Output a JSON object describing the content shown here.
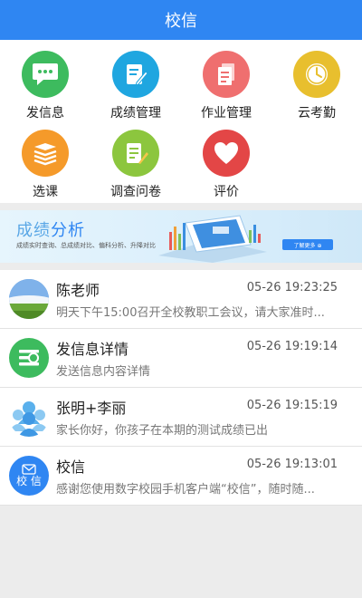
{
  "header": {
    "title": "校信"
  },
  "menu": [
    {
      "label": "发信息",
      "icon": "chat-bubble-icon",
      "color": "#3dbb5e"
    },
    {
      "label": "成绩管理",
      "icon": "edit-document-icon",
      "color": "#1fa6e0"
    },
    {
      "label": "作业管理",
      "icon": "documents-icon",
      "color": "#ef6f6f"
    },
    {
      "label": "云考勤",
      "icon": "clock-icon",
      "color": "#e8bf2e"
    },
    {
      "label": "选课",
      "icon": "book-stack-icon",
      "color": "#f59a2a"
    },
    {
      "label": "调查问卷",
      "icon": "survey-pencil-icon",
      "color": "#8cc63e"
    },
    {
      "label": "评价",
      "icon": "heart-icon",
      "color": "#e34646"
    }
  ],
  "banner": {
    "title_a": "成绩",
    "title_b": "分析",
    "subtitle": "成绩实时查询、总成绩对比、偏科分析、升降对比",
    "button": "了解更多 ⊕"
  },
  "messages": [
    {
      "name": "陈老师",
      "time": "05-26 19:23:25",
      "text": "明天下午15:00召开全校教职工会议，请大家准时...",
      "avatar": "landscape-avatar"
    },
    {
      "name": "发信息详情",
      "time": "05-26 19:19:14",
      "text": "发送信息内容详情",
      "avatar": "message-list-icon"
    },
    {
      "name": "张明+李丽",
      "time": "05-26 19:15:19",
      "text": "家长你好，你孩子在本期的测试成绩已出",
      "avatar": "group-users-icon"
    },
    {
      "name": "校信",
      "time": "05-26 19:13:01",
      "text": "感谢您使用数字校园手机客户端“校信”，随时随...",
      "avatar": "xiaoxin-logo-icon",
      "avatar_text": "校 信"
    }
  ]
}
